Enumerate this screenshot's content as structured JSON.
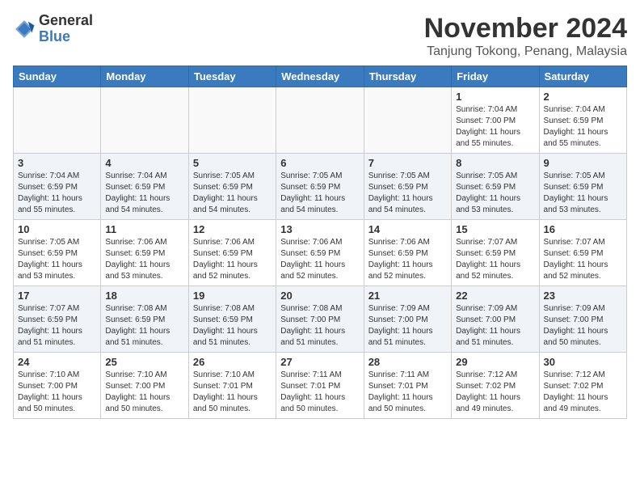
{
  "logo": {
    "general": "General",
    "blue": "Blue"
  },
  "title": {
    "month": "November 2024",
    "location": "Tanjung Tokong, Penang, Malaysia"
  },
  "weekdays": [
    "Sunday",
    "Monday",
    "Tuesday",
    "Wednesday",
    "Thursday",
    "Friday",
    "Saturday"
  ],
  "weeks": [
    [
      {
        "day": "",
        "empty": true
      },
      {
        "day": "",
        "empty": true
      },
      {
        "day": "",
        "empty": true
      },
      {
        "day": "",
        "empty": true
      },
      {
        "day": "",
        "empty": true
      },
      {
        "day": "1",
        "sunrise": "7:04 AM",
        "sunset": "7:00 PM",
        "daylight": "11 hours and 55 minutes."
      },
      {
        "day": "2",
        "sunrise": "7:04 AM",
        "sunset": "6:59 PM",
        "daylight": "11 hours and 55 minutes."
      }
    ],
    [
      {
        "day": "3",
        "sunrise": "7:04 AM",
        "sunset": "6:59 PM",
        "daylight": "11 hours and 55 minutes."
      },
      {
        "day": "4",
        "sunrise": "7:04 AM",
        "sunset": "6:59 PM",
        "daylight": "11 hours and 54 minutes."
      },
      {
        "day": "5",
        "sunrise": "7:05 AM",
        "sunset": "6:59 PM",
        "daylight": "11 hours and 54 minutes."
      },
      {
        "day": "6",
        "sunrise": "7:05 AM",
        "sunset": "6:59 PM",
        "daylight": "11 hours and 54 minutes."
      },
      {
        "day": "7",
        "sunrise": "7:05 AM",
        "sunset": "6:59 PM",
        "daylight": "11 hours and 54 minutes."
      },
      {
        "day": "8",
        "sunrise": "7:05 AM",
        "sunset": "6:59 PM",
        "daylight": "11 hours and 53 minutes."
      },
      {
        "day": "9",
        "sunrise": "7:05 AM",
        "sunset": "6:59 PM",
        "daylight": "11 hours and 53 minutes."
      }
    ],
    [
      {
        "day": "10",
        "sunrise": "7:05 AM",
        "sunset": "6:59 PM",
        "daylight": "11 hours and 53 minutes."
      },
      {
        "day": "11",
        "sunrise": "7:06 AM",
        "sunset": "6:59 PM",
        "daylight": "11 hours and 53 minutes."
      },
      {
        "day": "12",
        "sunrise": "7:06 AM",
        "sunset": "6:59 PM",
        "daylight": "11 hours and 52 minutes."
      },
      {
        "day": "13",
        "sunrise": "7:06 AM",
        "sunset": "6:59 PM",
        "daylight": "11 hours and 52 minutes."
      },
      {
        "day": "14",
        "sunrise": "7:06 AM",
        "sunset": "6:59 PM",
        "daylight": "11 hours and 52 minutes."
      },
      {
        "day": "15",
        "sunrise": "7:07 AM",
        "sunset": "6:59 PM",
        "daylight": "11 hours and 52 minutes."
      },
      {
        "day": "16",
        "sunrise": "7:07 AM",
        "sunset": "6:59 PM",
        "daylight": "11 hours and 52 minutes."
      }
    ],
    [
      {
        "day": "17",
        "sunrise": "7:07 AM",
        "sunset": "6:59 PM",
        "daylight": "11 hours and 51 minutes."
      },
      {
        "day": "18",
        "sunrise": "7:08 AM",
        "sunset": "6:59 PM",
        "daylight": "11 hours and 51 minutes."
      },
      {
        "day": "19",
        "sunrise": "7:08 AM",
        "sunset": "6:59 PM",
        "daylight": "11 hours and 51 minutes."
      },
      {
        "day": "20",
        "sunrise": "7:08 AM",
        "sunset": "7:00 PM",
        "daylight": "11 hours and 51 minutes."
      },
      {
        "day": "21",
        "sunrise": "7:09 AM",
        "sunset": "7:00 PM",
        "daylight": "11 hours and 51 minutes."
      },
      {
        "day": "22",
        "sunrise": "7:09 AM",
        "sunset": "7:00 PM",
        "daylight": "11 hours and 51 minutes."
      },
      {
        "day": "23",
        "sunrise": "7:09 AM",
        "sunset": "7:00 PM",
        "daylight": "11 hours and 50 minutes."
      }
    ],
    [
      {
        "day": "24",
        "sunrise": "7:10 AM",
        "sunset": "7:00 PM",
        "daylight": "11 hours and 50 minutes."
      },
      {
        "day": "25",
        "sunrise": "7:10 AM",
        "sunset": "7:00 PM",
        "daylight": "11 hours and 50 minutes."
      },
      {
        "day": "26",
        "sunrise": "7:10 AM",
        "sunset": "7:01 PM",
        "daylight": "11 hours and 50 minutes."
      },
      {
        "day": "27",
        "sunrise": "7:11 AM",
        "sunset": "7:01 PM",
        "daylight": "11 hours and 50 minutes."
      },
      {
        "day": "28",
        "sunrise": "7:11 AM",
        "sunset": "7:01 PM",
        "daylight": "11 hours and 50 minutes."
      },
      {
        "day": "29",
        "sunrise": "7:12 AM",
        "sunset": "7:02 PM",
        "daylight": "11 hours and 49 minutes."
      },
      {
        "day": "30",
        "sunrise": "7:12 AM",
        "sunset": "7:02 PM",
        "daylight": "11 hours and 49 minutes."
      }
    ]
  ]
}
